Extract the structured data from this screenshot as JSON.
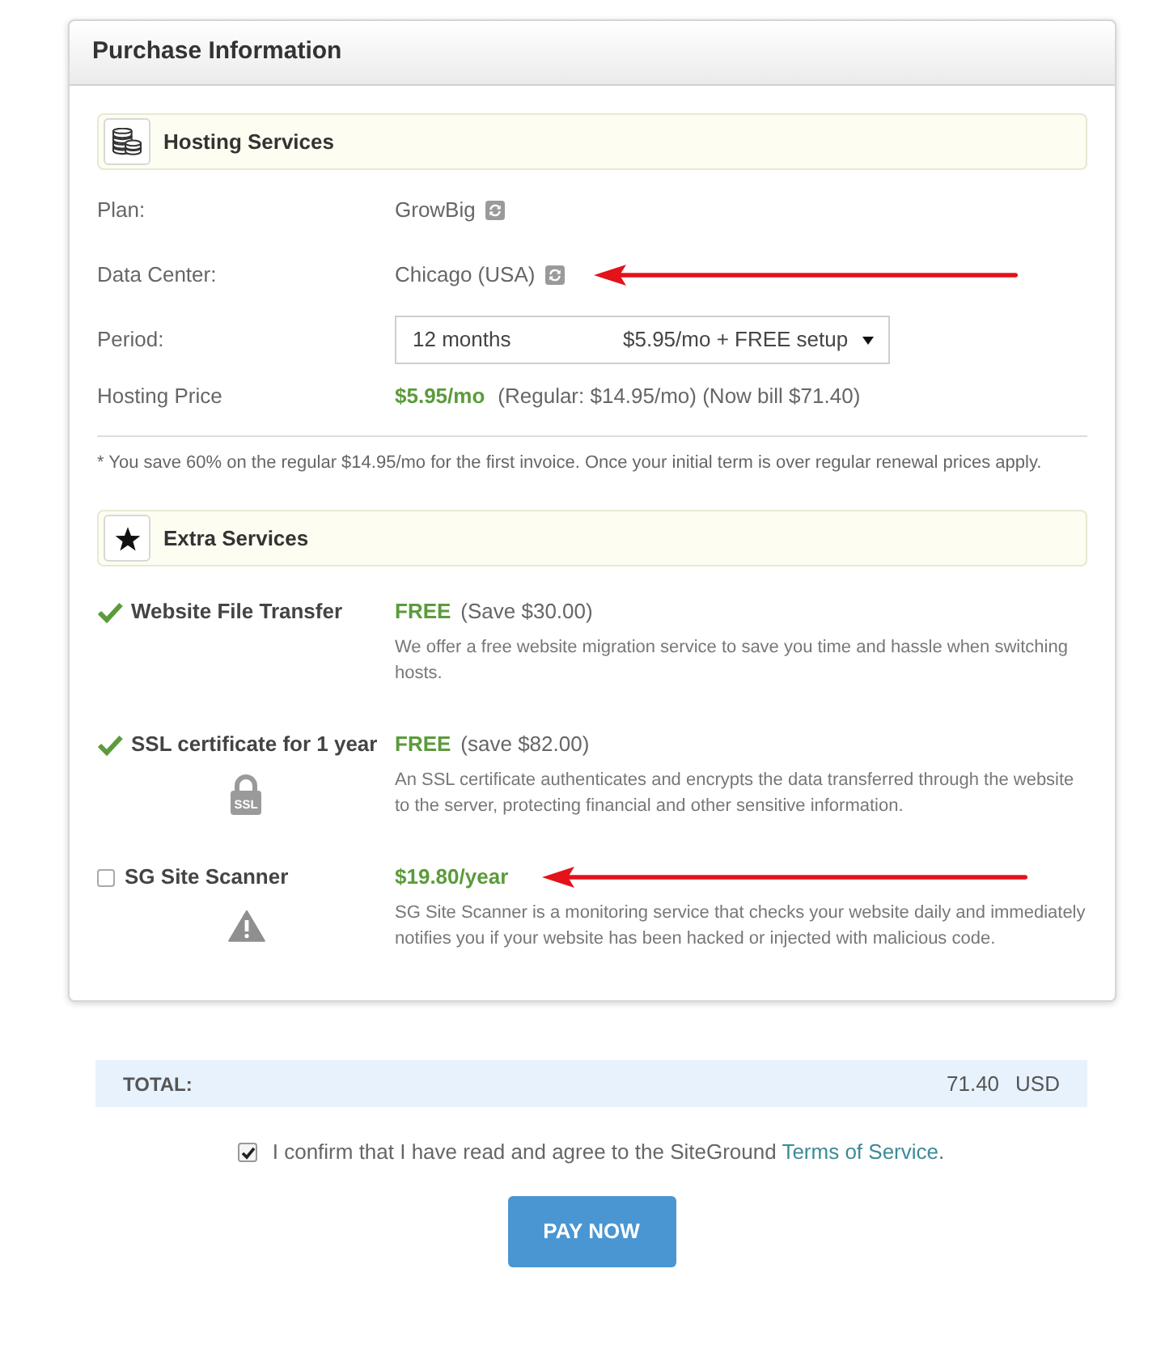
{
  "panel": {
    "title": "Purchase Information"
  },
  "hosting": {
    "title": "Hosting Services",
    "rows": [
      {
        "kind": "info",
        "label": "Plan:",
        "value": "GrowBig",
        "changeable": true,
        "annotated": false
      },
      {
        "kind": "info",
        "label": "Data Center:",
        "value": "Chicago (USA)",
        "changeable": true,
        "annotated": true
      },
      {
        "kind": "select",
        "label": "Period:",
        "value": "12 months",
        "price": "$5.95/mo + FREE setup"
      },
      {
        "kind": "price",
        "label": "Hosting Price",
        "price": "$5.95/mo",
        "details": "(Regular: $14.95/mo) (Now bill $71.40)"
      }
    ],
    "note": "* You save 60% on the regular $14.95/mo for the first invoice. Once your initial term is over regular renewal prices apply."
  },
  "extras": {
    "title": "Extra Services",
    "items": [
      {
        "kind": "included",
        "checked": true,
        "name": "Website File Transfer",
        "price": "FREE",
        "saving": "(Save $30.00)",
        "description": "We offer a free website migration service to save you time and hassle when switching hosts.",
        "annotated": false
      },
      {
        "kind": "included",
        "checked": true,
        "name": "SSL certificate for 1 year",
        "badge": {
          "kind": "padlock",
          "label": "SSL"
        },
        "price": "FREE",
        "saving": "(save $82.00)",
        "description": "An SSL certificate authenticates and encrypts the data transferred through the website to the server, protecting financial and other sensitive information.",
        "annotated": false
      },
      {
        "kind": "optional",
        "checked": false,
        "name": "SG Site Scanner",
        "badge": {
          "kind": "alert"
        },
        "price": "$19.80/year",
        "description": "SG Site Scanner is a monitoring service that checks your website daily and immediately notifies you if your website has been hacked or injected with malicious code.",
        "annotated": true
      }
    ]
  },
  "total": {
    "label": "TOTAL:",
    "amount": "71.40",
    "currency": "USD"
  },
  "agreement": {
    "checked": true,
    "text": "I confirm that I have read and agree to the SiteGround ",
    "link": "Terms of Service",
    "suffix": "."
  },
  "pay_button": {
    "label": "PAY NOW"
  }
}
